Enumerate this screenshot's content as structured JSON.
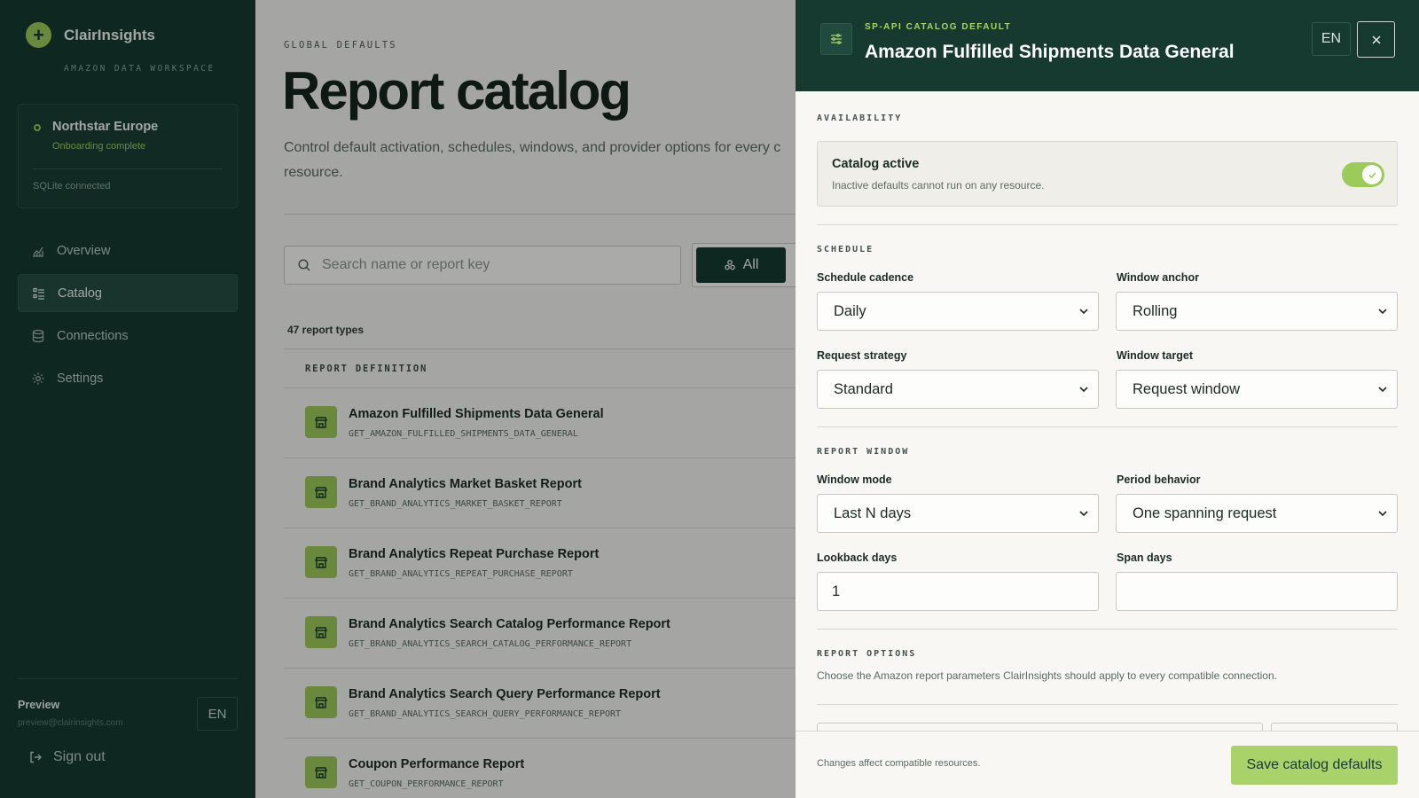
{
  "sidebar": {
    "brand_name": "ClairInsights",
    "brand_sub": "AMAZON DATA WORKSPACE",
    "workspace": {
      "name": "Northstar Europe",
      "status": "Onboarding complete",
      "db": "SQLite connected"
    },
    "nav": [
      {
        "label": "Overview",
        "icon": "chart-icon"
      },
      {
        "label": "Catalog",
        "icon": "list-icon",
        "active": true
      },
      {
        "label": "Connections",
        "icon": "database-icon"
      },
      {
        "label": "Settings",
        "icon": "gear-icon"
      }
    ],
    "preview_label": "Preview",
    "preview_email": "preview@clairinsights.com",
    "lang": "EN",
    "signout": "Sign out"
  },
  "main": {
    "eyebrow": "GLOBAL DEFAULTS",
    "title": "Report catalog",
    "description": "Control default activation, schedules, windows, and provider options for every c resource.",
    "search_placeholder": "Search name or report key",
    "filter_all": "All",
    "count": "47 report types",
    "table_header": "REPORT DEFINITION",
    "rows": [
      {
        "name": "Amazon Fulfilled Shipments Data General",
        "key": "GET_AMAZON_FULFILLED_SHIPMENTS_DATA_GENERAL"
      },
      {
        "name": "Brand Analytics Market Basket Report",
        "key": "GET_BRAND_ANALYTICS_MARKET_BASKET_REPORT"
      },
      {
        "name": "Brand Analytics Repeat Purchase Report",
        "key": "GET_BRAND_ANALYTICS_REPEAT_PURCHASE_REPORT"
      },
      {
        "name": "Brand Analytics Search Catalog Performance Report",
        "key": "GET_BRAND_ANALYTICS_SEARCH_CATALOG_PERFORMANCE_REPORT"
      },
      {
        "name": "Brand Analytics Search Query Performance Report",
        "key": "GET_BRAND_ANALYTICS_SEARCH_QUERY_PERFORMANCE_REPORT"
      },
      {
        "name": "Coupon Performance Report",
        "key": "GET_COUPON_PERFORMANCE_REPORT"
      }
    ]
  },
  "drawer": {
    "eyebrow": "SP-API CATALOG DEFAULT",
    "title": "Amazon Fulfilled Shipments Data General",
    "lang": "EN",
    "availability": {
      "section": "AVAILABILITY",
      "title": "Catalog active",
      "desc": "Inactive defaults cannot run on any resource.",
      "enabled": true
    },
    "schedule": {
      "section": "SCHEDULE",
      "cadence_label": "Schedule cadence",
      "cadence": "Daily",
      "anchor_label": "Window anchor",
      "anchor": "Rolling",
      "strategy_label": "Request strategy",
      "strategy": "Standard",
      "target_label": "Window target",
      "target": "Request window"
    },
    "report_window": {
      "section": "REPORT WINDOW",
      "mode_label": "Window mode",
      "mode": "Last N days",
      "period_label": "Period behavior",
      "period": "One spanning request",
      "lookback_label": "Lookback days",
      "lookback": "1",
      "span_label": "Span days",
      "span": ""
    },
    "report_options": {
      "section": "REPORT OPTIONS",
      "desc": "Choose the Amazon report parameters ClairInsights should apply to every compatible connection."
    },
    "footer_note": "Changes affect compatible resources.",
    "save_label": "Save catalog defaults"
  },
  "colors": {
    "brand_dark": "#163a30",
    "accent": "#9ccb5a",
    "accent_light": "#a9d36a"
  }
}
